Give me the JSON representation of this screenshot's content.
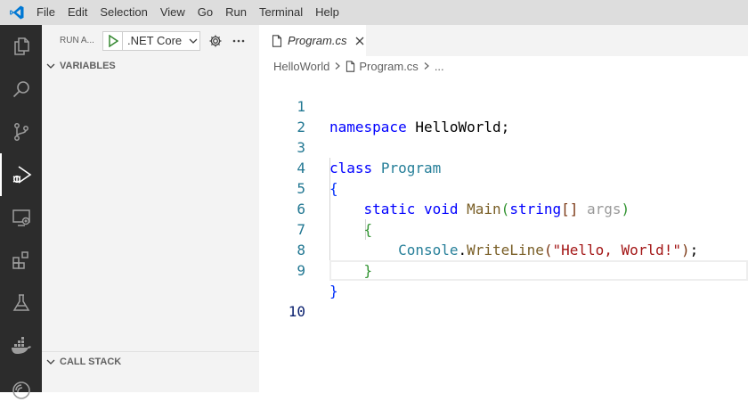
{
  "menu": [
    "File",
    "Edit",
    "Selection",
    "View",
    "Go",
    "Run",
    "Terminal",
    "Help"
  ],
  "activity_bar": [
    {
      "name": "explorer-icon"
    },
    {
      "name": "search-icon"
    },
    {
      "name": "source-control-icon"
    },
    {
      "name": "run-debug-icon",
      "active": true
    },
    {
      "name": "remote-explorer-icon"
    },
    {
      "name": "extensions-icon"
    },
    {
      "name": "testing-icon"
    },
    {
      "name": "docker-icon"
    },
    {
      "name": "live-share-icon"
    }
  ],
  "sidebar": {
    "run_label": "RUN A...",
    "config_name": ".NET Core",
    "variables_title": "VARIABLES",
    "call_stack_title": "CALL STACK"
  },
  "tab": {
    "label": "Program.cs"
  },
  "breadcrumbs": {
    "root": "HelloWorld",
    "file": "Program.cs",
    "more": "..."
  },
  "code": {
    "line_numbers": [
      "1",
      "2",
      "3",
      "4",
      "5",
      "6",
      "7",
      "8",
      "9",
      "10"
    ],
    "current_line": "10",
    "tokens": {
      "l1_kw": "namespace",
      "l1_name": "HelloWorld",
      "l1_semi": ";",
      "l3_kw": "class",
      "l3_name": "Program",
      "l4_brace": "{",
      "l5_static": "static",
      "l5_void": "void",
      "l5_main": "Main",
      "l5_paren_open": "(",
      "l5_string": "string",
      "l5_brackets": "[]",
      "l5_args": "args",
      "l5_paren_close": ")",
      "l6_brace": "{",
      "l7_console": "Console",
      "l7_dot": ".",
      "l7_method": "WriteLine",
      "l7_paren_open": "(",
      "l7_str": "\"Hello, World!\"",
      "l7_paren_close": ")",
      "l7_semi": ";",
      "l8_brace": "}",
      "l9_brace": "}"
    }
  },
  "colors": {
    "activity_bar_bg": "#2c2c2c",
    "sidebar_bg": "#f3f3f3",
    "titlebar_bg": "#dddddd",
    "keyword": "#0000ff",
    "type": "#267f99",
    "function": "#795e26",
    "string": "#a31515",
    "line_number": "#237893"
  }
}
